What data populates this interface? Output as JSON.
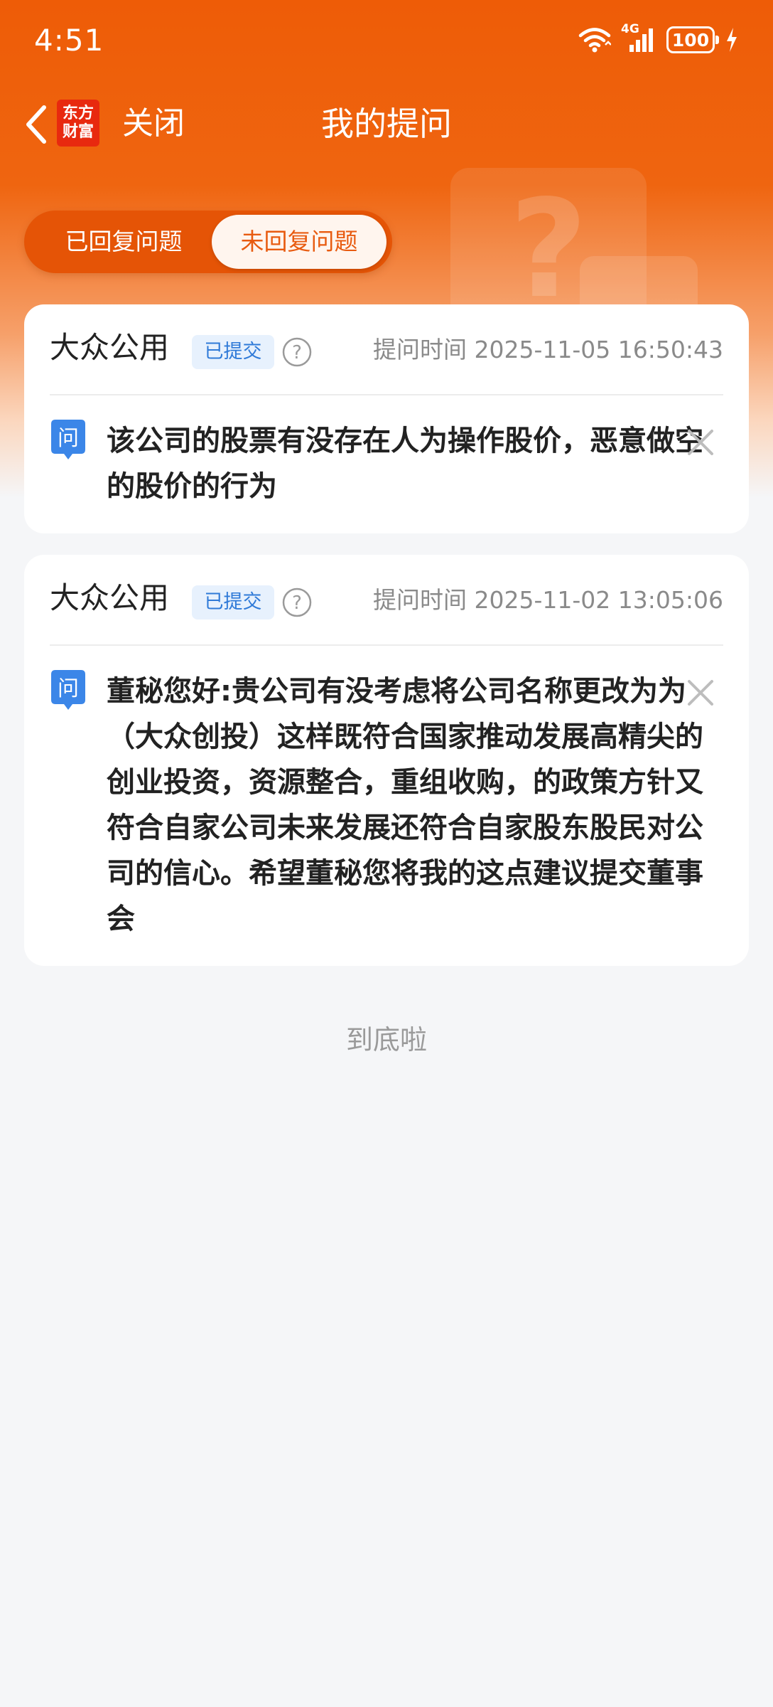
{
  "status_bar": {
    "time": "4:51",
    "network_label": "4G",
    "battery": "100",
    "icons": [
      "wifi-icon",
      "signal-icon",
      "battery-icon",
      "charging-icon"
    ]
  },
  "nav": {
    "back_icon": "chevron-left-icon",
    "logo_line1": "东方",
    "logo_line2": "财富",
    "close_label": "关闭",
    "title": "我的提问"
  },
  "tabs": {
    "answered": "已回复问题",
    "unanswered": "未回复问题",
    "selected": "unanswered"
  },
  "questions": [
    {
      "company": "大众公用",
      "status": "已提交",
      "time": "提问时间 2025-11-05 16:50:43",
      "q_label": "问",
      "text": "该公司的股票有没存在人为操作股价，恶意做空的股价的行为"
    },
    {
      "company": "大众公用",
      "status": "已提交",
      "time": "提问时间 2025-11-02 13:05:06",
      "q_label": "问",
      "text": "董秘您好:贵公司有没考虑将公司名称更改为为（大众创投）这样既符合国家推动发展高精尖的创业投资，资源整合，重组收购，的政策方针又符合自家公司未来发展还符合自家股东股民对公司的信心。希望董秘您将我的这点建议提交董事会"
    }
  ],
  "footer": {
    "end_text": "到底啦"
  },
  "colors": {
    "brand_orange": "#ee5c07",
    "badge_blue": "#2f7ad8",
    "question_blue": "#3b86e8"
  }
}
